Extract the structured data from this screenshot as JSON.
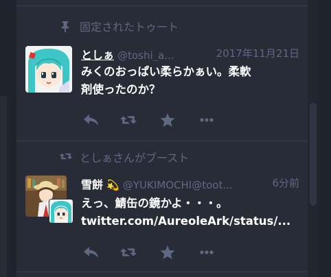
{
  "pinned": {
    "prepend_text": "固定されたトゥート",
    "display_name": "としぁ",
    "acct": "@toshi_a...",
    "time": "2017年11月21日",
    "content_line1": "みくのおっぱい柔らかぁい。柔軟",
    "content_line2": "剤使ったのか？"
  },
  "boosted": {
    "prepend_text": "としぁさんがブースト",
    "display_name": "雪餅",
    "emoji": "💫",
    "acct": "@YUKIMOCHI@toot...",
    "time": "6分前",
    "content_line1": "えっ、鯖缶の鏡かよ・・・。",
    "link_text": "twitter.com/AureoleArk/status/..."
  },
  "actions": {
    "reply": "reply-icon",
    "boost": "boost-icon",
    "favourite": "star-icon",
    "more": "ellipsis-icon"
  },
  "colors": {
    "background": "#282c37",
    "muted": "#606984",
    "text": "#ffffff",
    "accent_hair": "#3ec6c6"
  }
}
